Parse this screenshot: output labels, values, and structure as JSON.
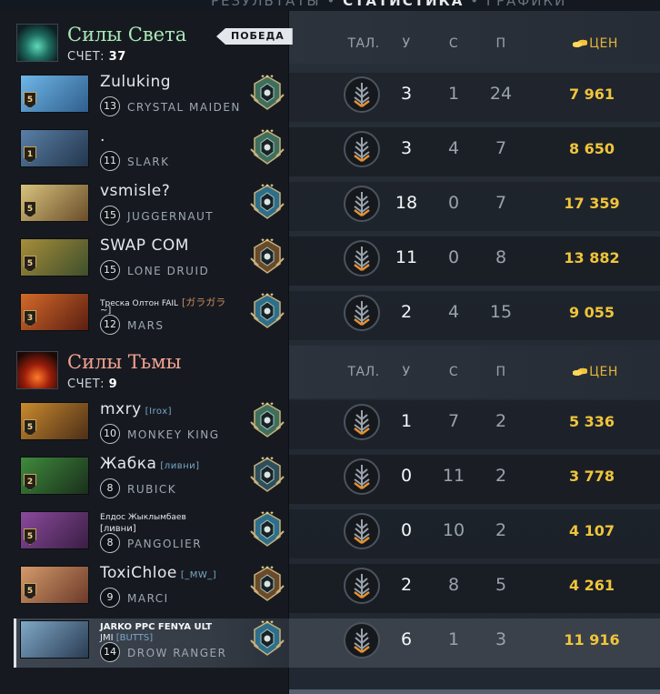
{
  "top_tabs": {
    "left": "РЕЗУЛЬТАТЫ",
    "sep": "•",
    "active": "СТАТИСТИКА",
    "right": "ГРАФИКИ"
  },
  "columns": {
    "talents": "ТАЛ.",
    "kills": "У",
    "deaths": "С",
    "assists": "П",
    "networth": "ЦЕН"
  },
  "colors": {
    "radiant": "#a9e8b6",
    "dire": "#f3a093",
    "gold": "#f0c43b",
    "victory_bg": "#e3e6ea"
  },
  "radiant": {
    "name": "Силы Света",
    "score_label": "СЧЕТ:",
    "score": "37",
    "badge": "ПОБЕДА",
    "players": [
      {
        "name": "Zuluking",
        "tag": "",
        "hero": "CRYSTAL MAIDEN",
        "level": "13",
        "rank_stars": "5",
        "kills": "3",
        "deaths": "1",
        "assists": "24",
        "networth": "7 961",
        "rank_icon": "rank-medal-icon"
      },
      {
        "name": ".",
        "tag": "",
        "hero": "SLARK",
        "level": "11",
        "rank_stars": "1",
        "kills": "3",
        "deaths": "4",
        "assists": "7",
        "networth": "8 650",
        "rank_icon": "rank-medal-icon"
      },
      {
        "name": "vsmisle?",
        "tag": "",
        "hero": "JUGGERNAUT",
        "level": "15",
        "rank_stars": "5",
        "kills": "18",
        "deaths": "0",
        "assists": "7",
        "networth": "17 359",
        "rank_icon": "rank-medal-icon"
      },
      {
        "name": "SWAP COM",
        "tag": "",
        "hero": "LONE DRUID",
        "level": "15",
        "rank_stars": "5",
        "kills": "11",
        "deaths": "0",
        "assists": "8",
        "networth": "13 882",
        "rank_icon": "rank-medal-icon"
      },
      {
        "name": "Треска Олтон FAIL",
        "tag": "[ガラガラ",
        "name_line2": "~]",
        "hero": "MARS",
        "level": "12",
        "rank_stars": "3",
        "kills": "2",
        "deaths": "4",
        "assists": "15",
        "networth": "9 055",
        "rank_icon": "rank-medal-icon"
      }
    ]
  },
  "dire": {
    "name": "Силы Тьмы",
    "score_label": "СЧЕТ:",
    "score": "9",
    "players": [
      {
        "name": "mxry",
        "tag": "[Irox]",
        "hero": "MONKEY KING",
        "level": "10",
        "rank_stars": "5",
        "kills": "1",
        "deaths": "7",
        "assists": "2",
        "networth": "5 336",
        "rank_icon": "rank-medal-icon"
      },
      {
        "name": "Жабка",
        "tag": "[ливни]",
        "hero": "RUBICK",
        "level": "8",
        "rank_stars": "2",
        "kills": "0",
        "deaths": "11",
        "assists": "2",
        "networth": "3 778",
        "rank_icon": "rank-medal-icon"
      },
      {
        "name": "Елдос Жыклымбаев",
        "tag": "",
        "name_line2": "[ливни]",
        "hero": "PANGOLIER",
        "level": "8",
        "rank_stars": "5",
        "kills": "0",
        "deaths": "10",
        "assists": "2",
        "networth": "4 107",
        "rank_icon": "rank-medal-icon"
      },
      {
        "name": "ToxiChloe",
        "tag": "[_MW_]",
        "hero": "MARCI",
        "level": "9",
        "rank_stars": "5",
        "kills": "2",
        "deaths": "8",
        "assists": "5",
        "networth": "4 261",
        "rank_icon": "rank-medal-icon"
      },
      {
        "name": "JARKO PPC FENYA ULT",
        "tag": "",
        "name_line2": "JMI",
        "tag2": "[BUTTS]",
        "hero": "DROW RANGER",
        "level": "14",
        "rank_stars": "",
        "kills": "6",
        "deaths": "1",
        "assists": "3",
        "networth": "11 916",
        "rank_icon": "rank-medal-icon"
      }
    ]
  }
}
